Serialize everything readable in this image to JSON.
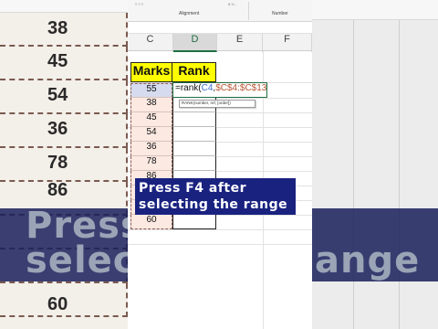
{
  "background": {
    "left_column_values": [
      "38",
      "45",
      "54",
      "36",
      "78",
      "86",
      "60"
    ],
    "caption_lines": [
      "Press",
      "selec",
      "ange"
    ]
  },
  "ribbon": {
    "alignment_label": "Alignment",
    "number_label": "Number"
  },
  "columns": [
    "C",
    "D",
    "E",
    "F"
  ],
  "table": {
    "headers": {
      "marks": "Marks",
      "rank": "Rank"
    },
    "marks": [
      "55",
      "38",
      "45",
      "54",
      "36",
      "78",
      "86",
      "",
      "",
      "60"
    ]
  },
  "formula": {
    "prefix": "=rank(",
    "ref1": "C4",
    "comma": ",",
    "ref2": "$C$4:$C$13",
    "tooltip": "RANK(number, ref, [order])"
  },
  "overlay": {
    "line1": "Press F4 after",
    "line2": "selecting the range"
  },
  "colors": {
    "header_fill": "#ffff00",
    "caption_bg": "#1a2280",
    "ref1": "#3a6fd1",
    "ref2": "#b5542f",
    "active_border": "#1f6e43"
  }
}
